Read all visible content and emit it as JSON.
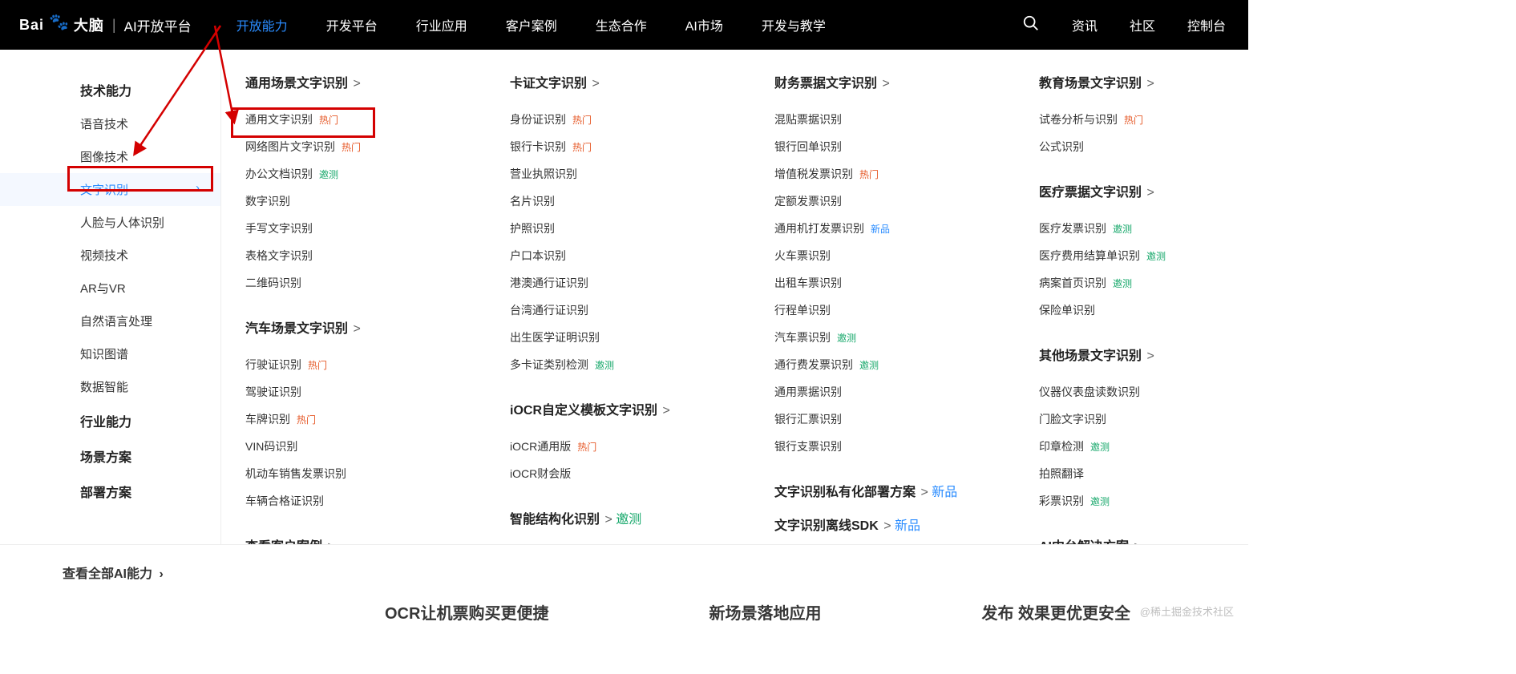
{
  "topnav": {
    "logo_brand_cn": "大脑",
    "logo_platform": "AI开放平台",
    "items": [
      {
        "label": "开放能力",
        "active": true
      },
      {
        "label": "开发平台"
      },
      {
        "label": "行业应用"
      },
      {
        "label": "客户案例"
      },
      {
        "label": "生态合作"
      },
      {
        "label": "AI市场"
      },
      {
        "label": "开发与教学"
      }
    ],
    "right": [
      "资讯",
      "社区",
      "控制台"
    ]
  },
  "sidebar": {
    "groups": [
      {
        "title": "技术能力",
        "items": [
          {
            "label": "语音技术"
          },
          {
            "label": "图像技术"
          },
          {
            "label": "文字识别",
            "active": true
          },
          {
            "label": "人脸与人体识别"
          },
          {
            "label": "视频技术"
          },
          {
            "label": "AR与VR"
          },
          {
            "label": "自然语言处理"
          },
          {
            "label": "知识图谱"
          },
          {
            "label": "数据智能"
          }
        ]
      },
      {
        "title": "行业能力",
        "items": []
      },
      {
        "title": "场景方案",
        "items": []
      },
      {
        "title": "部署方案",
        "items": []
      }
    ],
    "see_all": "查看全部AI能力"
  },
  "tags": {
    "hot": "热门",
    "yaoce": "邀测",
    "new": "新品"
  },
  "columns": [
    {
      "sections": [
        {
          "title": "通用场景文字识别",
          "items": [
            {
              "label": "通用文字识别",
              "tag": "hot",
              "highlight": true
            },
            {
              "label": "网络图片文字识别",
              "tag": "hot"
            },
            {
              "label": "办公文档识别",
              "tag": "yaoce"
            },
            {
              "label": "数字识别"
            },
            {
              "label": "手写文字识别"
            },
            {
              "label": "表格文字识别"
            },
            {
              "label": "二维码识别"
            }
          ]
        },
        {
          "title": "汽车场景文字识别",
          "items": [
            {
              "label": "行驶证识别",
              "tag": "hot"
            },
            {
              "label": "驾驶证识别"
            },
            {
              "label": "车牌识别",
              "tag": "hot"
            },
            {
              "label": "VIN码识别"
            },
            {
              "label": "机动车销售发票识别"
            },
            {
              "label": "车辆合格证识别"
            }
          ]
        },
        {
          "title": "查看客户案例",
          "items": []
        }
      ]
    },
    {
      "sections": [
        {
          "title": "卡证文字识别",
          "items": [
            {
              "label": "身份证识别",
              "tag": "hot"
            },
            {
              "label": "银行卡识别",
              "tag": "hot"
            },
            {
              "label": "营业执照识别"
            },
            {
              "label": "名片识别"
            },
            {
              "label": "护照识别"
            },
            {
              "label": "户口本识别"
            },
            {
              "label": "港澳通行证识别"
            },
            {
              "label": "台湾通行证识别"
            },
            {
              "label": "出生医学证明识别"
            },
            {
              "label": "多卡证类别检测",
              "tag": "yaoce"
            }
          ]
        },
        {
          "title": "iOCR自定义模板文字识别",
          "items": [
            {
              "label": "iOCR通用版",
              "tag": "hot"
            },
            {
              "label": "iOCR财会版"
            }
          ]
        },
        {
          "title": "智能结构化识别",
          "title_tag": "yaoce",
          "items": []
        }
      ]
    },
    {
      "sections": [
        {
          "title": "财务票据文字识别",
          "items": [
            {
              "label": "混贴票据识别"
            },
            {
              "label": "银行回单识别"
            },
            {
              "label": "增值税发票识别",
              "tag": "hot"
            },
            {
              "label": "定额发票识别"
            },
            {
              "label": "通用机打发票识别",
              "tag": "new"
            },
            {
              "label": "火车票识别"
            },
            {
              "label": "出租车票识别"
            },
            {
              "label": "行程单识别"
            },
            {
              "label": "汽车票识别",
              "tag": "yaoce"
            },
            {
              "label": "通行费发票识别",
              "tag": "yaoce"
            },
            {
              "label": "通用票据识别"
            },
            {
              "label": "银行汇票识别"
            },
            {
              "label": "银行支票识别"
            }
          ]
        },
        {
          "title": "文字识别私有化部署方案",
          "title_tag": "new",
          "items": []
        },
        {
          "title": "文字识别离线SDK",
          "title_tag": "new",
          "items": []
        }
      ]
    },
    {
      "sections": [
        {
          "title": "教育场景文字识别",
          "items": [
            {
              "label": "试卷分析与识别",
              "tag": "hot"
            },
            {
              "label": "公式识别"
            }
          ]
        },
        {
          "title": "医疗票据文字识别",
          "items": [
            {
              "label": "医疗发票识别",
              "tag": "yaoce"
            },
            {
              "label": "医疗费用结算单识别",
              "tag": "yaoce"
            },
            {
              "label": "病案首页识别",
              "tag": "yaoce"
            },
            {
              "label": "保险单识别"
            }
          ]
        },
        {
          "title": "其他场景文字识别",
          "items": [
            {
              "label": "仪器仪表盘读数识别"
            },
            {
              "label": "门脸文字识别"
            },
            {
              "label": "印章检测",
              "tag": "yaoce"
            },
            {
              "label": "拍照翻译"
            },
            {
              "label": "彩票识别",
              "tag": "yaoce"
            }
          ]
        },
        {
          "title": "AI中台解决方案",
          "items": []
        }
      ]
    }
  ],
  "watermark": "@稀土掘金技术社区",
  "bottom_strip": [
    "OCR让机票购买更便捷",
    "新场景落地应用",
    "发布 效果更优更安全"
  ]
}
